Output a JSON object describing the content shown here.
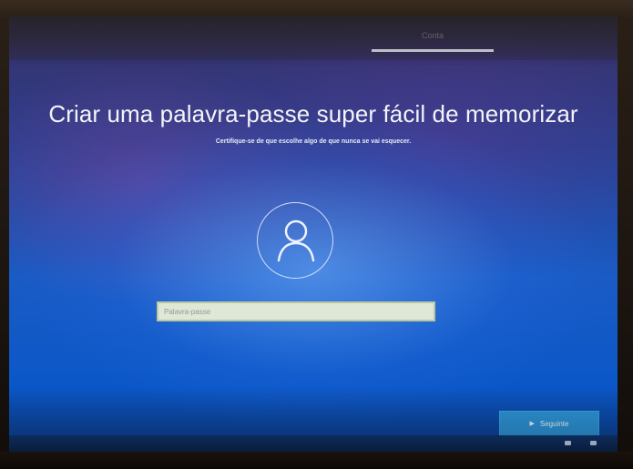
{
  "header": {
    "step_label": "Conta"
  },
  "main": {
    "title": "Criar uma palavra-passe super fácil de memorizar",
    "subtitle": "Certifique-se de que escolhe algo de que nunca se vai esquecer.",
    "avatar_icon": "user-icon",
    "password": {
      "value": "",
      "placeholder": "Palavra-passe"
    }
  },
  "footer": {
    "next_label": "Seguinte",
    "next_icon": "cursor-icon",
    "tray_icons": [
      "keyboard-icon",
      "accessibility-icon"
    ]
  },
  "colors": {
    "accent": "#2c93d6",
    "background_blue": "#0b57c8",
    "text": "#f2f4f8"
  }
}
